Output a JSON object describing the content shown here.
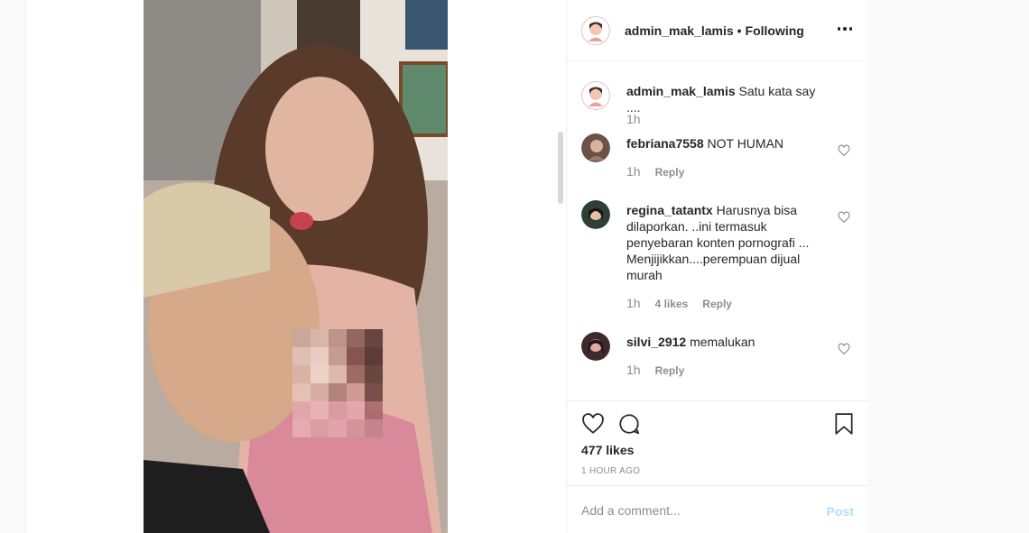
{
  "post": {
    "author": "admin_mak_lamis",
    "separator": "•",
    "follow_status": "Following",
    "image_alt": "post photo"
  },
  "caption": {
    "user": "admin_mak_lamis",
    "text": "Satu kata say ....",
    "time": "1h"
  },
  "comments": [
    {
      "user": "febriana7558",
      "text": "NOT HUMAN",
      "time": "1h",
      "likes": "",
      "reply": "Reply"
    },
    {
      "user": "regina_tatantx",
      "text": "Harusnya bisa dilaporkan. ..ini termasuk penyebaran konten pornografi ... Menjijikkan....perempuan dijual murah",
      "time": "1h",
      "likes": "4 likes",
      "reply": "Reply"
    },
    {
      "user": "silvi_2912",
      "text": "memalukan",
      "time": "1h",
      "likes": "",
      "reply": "Reply"
    }
  ],
  "actions": {
    "like_icon": "heart-icon",
    "comment_icon": "comment-icon",
    "save_icon": "bookmark-icon",
    "likes_count": "477 likes",
    "posted_ago": "1 HOUR AGO"
  },
  "add_comment": {
    "placeholder": "Add a comment...",
    "post_label": "Post",
    "post_color": "#b2dffc"
  }
}
